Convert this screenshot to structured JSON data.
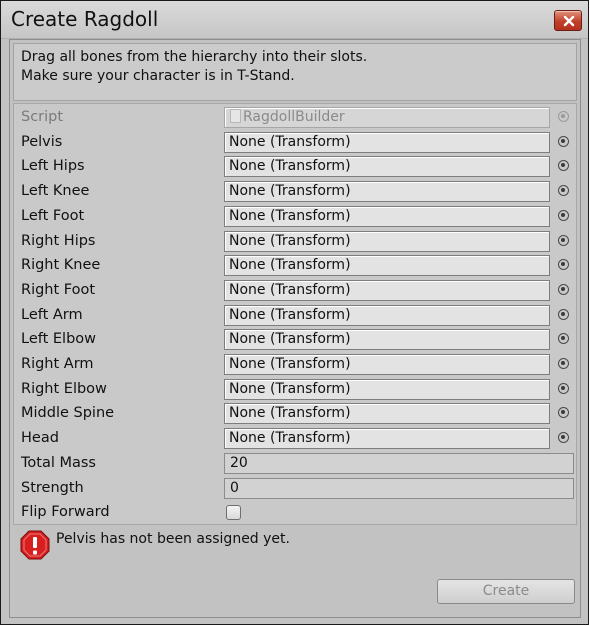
{
  "window": {
    "title": "Create Ragdoll",
    "close_icon": "close-icon"
  },
  "help": {
    "line1": "Drag all bones from the hierarchy into their slots.",
    "line2": "Make sure your character is in T-Stand."
  },
  "script_row": {
    "label": "Script",
    "value": "RagdollBuilder"
  },
  "bones": [
    {
      "label": "Pelvis",
      "value": "None (Transform)"
    },
    {
      "label": "Left Hips",
      "value": "None (Transform)"
    },
    {
      "label": "Left Knee",
      "value": "None (Transform)"
    },
    {
      "label": "Left Foot",
      "value": "None (Transform)"
    },
    {
      "label": "Right Hips",
      "value": "None (Transform)"
    },
    {
      "label": "Right Knee",
      "value": "None (Transform)"
    },
    {
      "label": "Right Foot",
      "value": "None (Transform)"
    },
    {
      "label": "Left Arm",
      "value": "None (Transform)"
    },
    {
      "label": "Left Elbow",
      "value": "None (Transform)"
    },
    {
      "label": "Right Arm",
      "value": "None (Transform)"
    },
    {
      "label": "Right Elbow",
      "value": "None (Transform)"
    },
    {
      "label": "Middle Spine",
      "value": "None (Transform)"
    },
    {
      "label": "Head",
      "value": "None (Transform)"
    }
  ],
  "total_mass": {
    "label": "Total Mass",
    "value": "20"
  },
  "strength": {
    "label": "Strength",
    "value": "0"
  },
  "flip_forward": {
    "label": "Flip Forward",
    "checked": false
  },
  "error": {
    "icon": "error-icon",
    "message": "Pelvis has not been assigned yet."
  },
  "create_button": {
    "label": "Create",
    "enabled": false
  },
  "colors": {
    "error_red": "#d81e1e",
    "close_button": "#c2402a"
  }
}
